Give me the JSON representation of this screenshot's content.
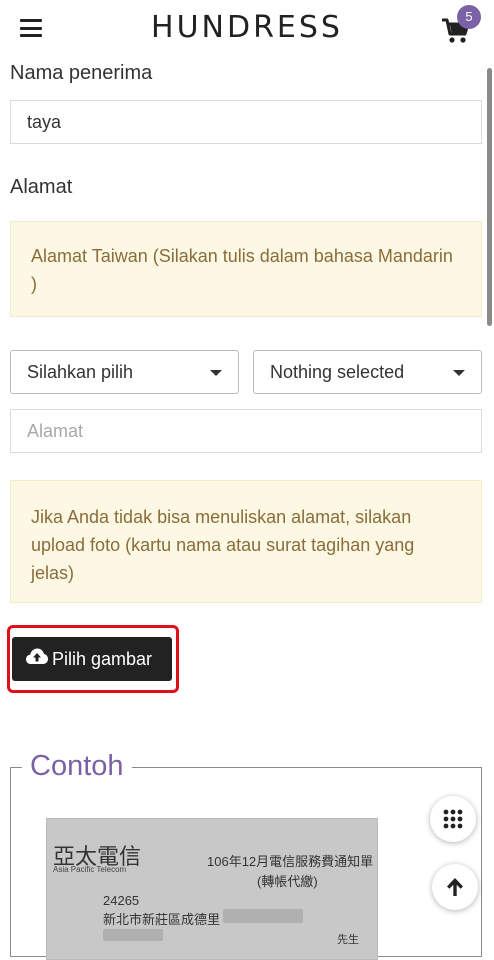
{
  "header": {
    "brand": "HUNDRESS",
    "cart_count": "5"
  },
  "form": {
    "recipient_label": "Nama penerima",
    "recipient_value": "taya",
    "address_label": "Alamat",
    "address_note": "Alamat Taiwan (Silakan tulis dalam bahasa Mandarin )",
    "city_select": "Silahkan pilih",
    "district_select": "Nothing selected",
    "address_placeholder": "Alamat",
    "upload_note": "Jika Anda tidak bisa menuliskan alamat, silakan upload foto (kartu nama atau surat tagihan yang jelas)",
    "upload_button": "Pilih gambar"
  },
  "example": {
    "legend": "Contoh",
    "company": "亞太電信",
    "company_en": "Asia Pacific Telecom",
    "notice": "106年12月電信服務費通知單",
    "notice_sub": "(轉帳代繳)",
    "zip": "24265",
    "address": "新北市新莊區成德里",
    "honorific": "先生"
  },
  "colors": {
    "accent": "#7b62a6",
    "note_bg": "#fcf8e3",
    "note_text": "#8a6d3b",
    "highlight": "#e0101a",
    "button_bg": "#222222"
  },
  "icons": {
    "menu": "hamburger-icon",
    "cart": "cart-icon",
    "upload": "cloud-upload-icon",
    "grid": "grid-dots-icon",
    "top": "arrow-up-icon"
  }
}
